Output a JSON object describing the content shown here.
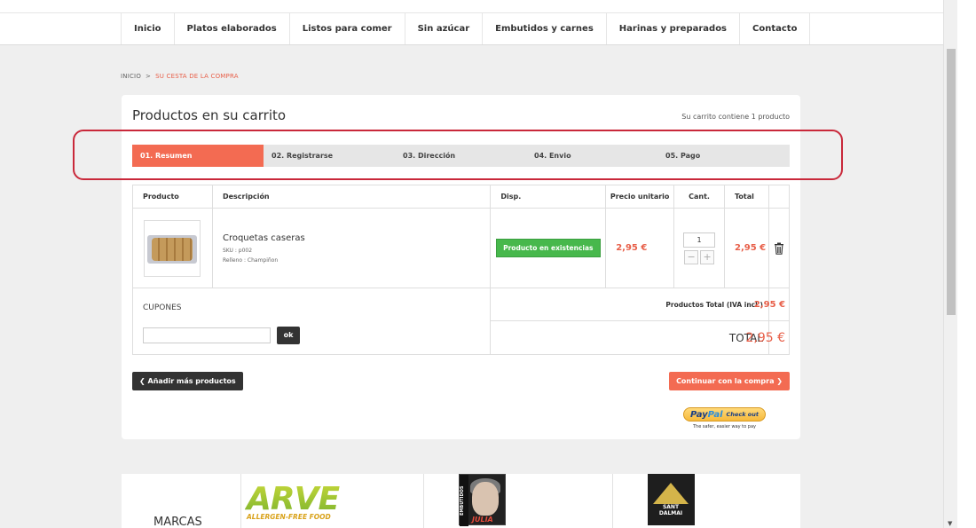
{
  "nav": {
    "items": [
      "Inicio",
      "Platos elaborados",
      "Listos para comer",
      "Sin azúcar",
      "Embutidos y carnes",
      "Harinas y preparados",
      "Contacto"
    ]
  },
  "breadcrumb": {
    "home": "INICIO",
    "separator": ">",
    "current": "SU CESTA DE LA COMPRA"
  },
  "cart": {
    "title": "Productos en su carrito",
    "count_text": "Su carrito contiene 1 producto",
    "steps": [
      "01. Resumen",
      "02. Registrarse",
      "03. Dirección",
      "04. Envio",
      "05. Pago"
    ],
    "active_step": 0,
    "columns": {
      "product": "Producto",
      "description": "Descripción",
      "availability": "Disp.",
      "unit_price": "Precio unitario",
      "qty": "Cant.",
      "total": "Total"
    },
    "item": {
      "name": "Croquetas caseras",
      "sku": "SKU : p002",
      "filling": "Relleno : Champiñon",
      "stock": "Producto en existencias",
      "unit_price": "2,95 €",
      "qty": "1",
      "qty_minus": "−",
      "qty_plus": "+",
      "total": "2,95 €"
    },
    "coupons": {
      "label": "CUPONES",
      "placeholder": "",
      "ok": "ok"
    },
    "summary": {
      "products_total_label": "Productos Total (IVA incl.)",
      "products_total_value": "2,95 €",
      "total_label": "TOTAL",
      "total_value": "2,95 €"
    },
    "buttons": {
      "add_more": "Añadir más productos",
      "continue": "Continuar con la compra"
    },
    "paypal": {
      "logo_a": "Pay",
      "logo_b": "Pal",
      "checkout": "Check out",
      "tagline": "The safer, easier way to pay"
    }
  },
  "brands": {
    "title": "MARCAS",
    "logos": {
      "arve": {
        "name": "ARVE",
        "tagline": "ALLERGEN-FREE FOOD"
      },
      "julia": {
        "side": "EMBUTIDOS",
        "name": "JULIA"
      },
      "sant": {
        "line1": "SANT",
        "line2": "DALMAI"
      }
    }
  },
  "colors": {
    "accent": "#f36b52",
    "price": "#e8604a",
    "stock": "#47b84c",
    "highlight": "#c9283a"
  }
}
